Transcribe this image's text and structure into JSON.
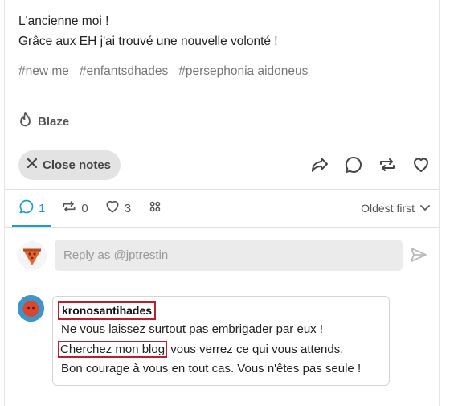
{
  "post": {
    "lines": [
      "L'ancienne moi !",
      "Grâce aux EH j'ai trouvé une nouvelle volonté !"
    ],
    "tags": [
      "#new me",
      "#enfantsdhades",
      "#persephonia aidoneus"
    ],
    "blaze_label": "Blaze"
  },
  "actions": {
    "close_notes_label": "Close notes",
    "icons": [
      "share-icon",
      "reply-icon",
      "reblog-icon",
      "like-icon"
    ]
  },
  "notes": {
    "tabs": [
      {
        "icon": "reply-icon",
        "count": "1",
        "active": true
      },
      {
        "icon": "reblog-icon",
        "count": "0",
        "active": false
      },
      {
        "icon": "heart-icon",
        "count": "3",
        "active": false
      },
      {
        "icon": "community-icon",
        "count": "",
        "active": false
      }
    ],
    "sort_label": "Oldest first"
  },
  "reply": {
    "placeholder": "Reply as @jptrestin"
  },
  "comment": {
    "author": "kronosantihades",
    "line1": "Ne vous laissez surtout pas embrigader par eux !",
    "line2_highlight": "Cherchez mon blog",
    "line2_rest": " vous verrez ce qui vous attends.",
    "line3": "Bon courage à vous en tout cas. Vous n'êtes pas seule !"
  },
  "colors": {
    "accent": "#1d9bd8",
    "highlight_border": "#b8202e",
    "muted": "#777777"
  }
}
